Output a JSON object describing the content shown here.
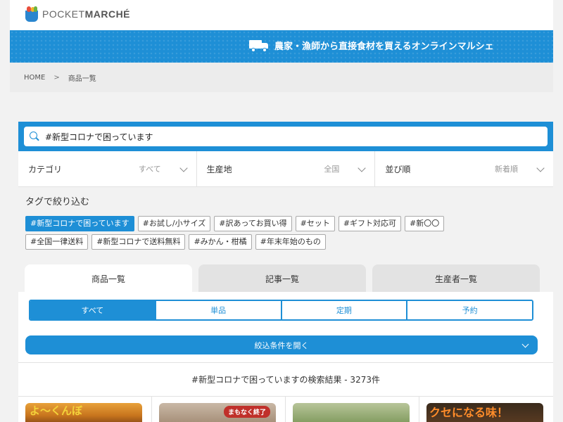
{
  "header": {
    "logo_light": "POCKET",
    "logo_bold": "MARCHÉ"
  },
  "banner": {
    "text": "農家・漁師から直接食材を買えるオンラインマルシェ"
  },
  "breadcrumb": {
    "home": "HOME",
    "separator": ">",
    "current": "商品一覧"
  },
  "search": {
    "value": "#新型コロナで困っています"
  },
  "filters": [
    {
      "label": "カテゴリ",
      "value": "すべて"
    },
    {
      "label": "生産地",
      "value": "全国"
    },
    {
      "label": "並び順",
      "value": "新着順"
    }
  ],
  "tags": {
    "title": "タグで絞り込む",
    "row1": [
      "#新型コロナで困っています",
      "#お試し/小サイズ",
      "#訳あってお買い得",
      "#セット",
      "#ギフト対応可",
      "#新〇〇"
    ],
    "row2": [
      "#全国一律送料",
      "#新型コロナで送料無料",
      "#みかん・柑橘",
      "#年末年始のもの"
    ],
    "active_index": 0
  },
  "tabs": [
    "商品一覧",
    "記事一覧",
    "生産者一覧"
  ],
  "segments": [
    "すべて",
    "単品",
    "定期",
    "予約"
  ],
  "narrow_button": "絞込条件を開く",
  "results_text": "#新型コロナで困っていますの検索結果 - 3273件",
  "products": [
    {
      "overlay_text": "よ〜くんぼ"
    },
    {
      "badge": "まもなく終了"
    },
    {},
    {
      "overlay_text": "クセになる味！"
    }
  ],
  "colors": {
    "accent": "#1e8fd6",
    "badge": "#c0302a"
  }
}
